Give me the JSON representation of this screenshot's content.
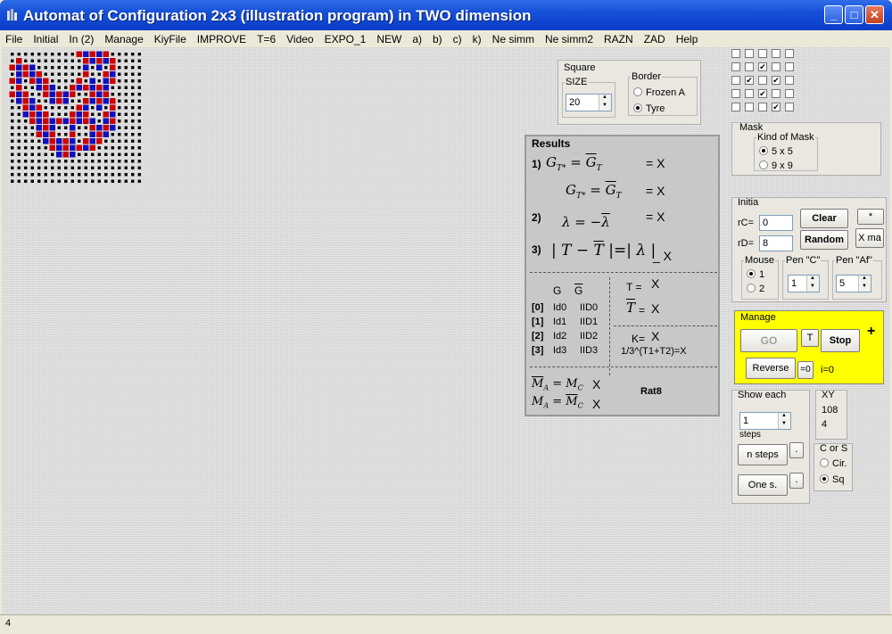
{
  "window": {
    "title": "Automat of Configuration 2x3 (illustration program) in TWO dimension"
  },
  "menu": [
    "File",
    "Initial",
    "In (2)",
    "Manage",
    "KiyFile",
    "IMPROVE",
    "T=6",
    "Video",
    "EXPO_1",
    "NEW",
    "a)",
    "b)",
    "c)",
    "k)",
    "Ne simm",
    "Ne simm2",
    "RAZN",
    "ZAD",
    "Help"
  ],
  "square": {
    "title": "Square",
    "size_label": "SIZE",
    "size_value": "20",
    "border_label": "Border",
    "border_options": [
      "Frozen A",
      "Tyre"
    ],
    "border_selected": "Tyre"
  },
  "results": {
    "title": "Results",
    "row1_num": "1)",
    "row2_num": "2)",
    "row3_num": "3)",
    "eq_x": "= X",
    "x": "X",
    "eq_modlambda": "_ X",
    "g_header": "G",
    "g_bar_header": "G",
    "rows": [
      {
        "idx": "[0]",
        "id": "Id0",
        "bid": "IID0"
      },
      {
        "idx": "[1]",
        "id": "Id1",
        "bid": "IID1"
      },
      {
        "idx": "[2]",
        "id": "Id2",
        "bid": "IID2"
      },
      {
        "idx": "[3]",
        "id": "Id3",
        "bid": "IID3"
      }
    ],
    "t_eq": "T =",
    "t_bar_eq": "=",
    "k_eq": "K=",
    "formula": "1/3^(T1+T2)=X",
    "rat": "Rat8"
  },
  "mask": {
    "title": "Mask",
    "kind_label": "Kind of Mask",
    "options": [
      "5 x 5",
      "9 x 9"
    ],
    "selected": "5 x 5"
  },
  "initia": {
    "title": "Initia",
    "rc_label": "rC=",
    "rc_value": "0",
    "rd_label": "rD=",
    "rd_value": "8",
    "clear_label": "Clear",
    "random_label": "Random",
    "small_label": "*",
    "xma_label": "X ma",
    "mouse_label": "Mouse",
    "mouse_options": [
      "1",
      "2"
    ],
    "mouse_selected": "1",
    "pen_c_label": "Pen \"C\"",
    "pen_c_value": "1",
    "pen_af_label": "Pen \"Af\"",
    "pen_af_value": "5"
  },
  "manage": {
    "title": "Manage",
    "go_label": "GO",
    "t_label": "T",
    "stop_label": "Stop",
    "plus_label": "+",
    "reverse_label": "Reverse",
    "zero_label": "=0",
    "i_text": "i=0"
  },
  "show_each": {
    "title": "Show each",
    "value": "1",
    "steps_label": "steps",
    "n_steps_label": "n steps",
    "one_label": "One s.",
    "dot_label": "."
  },
  "xy": {
    "title": "XY",
    "x_value": "108",
    "y_value": "4"
  },
  "cors": {
    "title": "C or S",
    "options": [
      "Cir.",
      "Sq"
    ],
    "selected": "Sq"
  },
  "status": {
    "text": "4"
  },
  "colors": {
    "title_bar": "#0a3cc8",
    "manage_bg": "#ffff00",
    "cell_red": "#cc0000",
    "cell_blue": "#1010c0",
    "cell_black": "#000000"
  },
  "checkgrid": [
    [
      0,
      0,
      0,
      0,
      0
    ],
    [
      0,
      0,
      1,
      0,
      0
    ],
    [
      0,
      1,
      0,
      1,
      0
    ],
    [
      0,
      0,
      1,
      0,
      0
    ],
    [
      0,
      0,
      0,
      1,
      0
    ]
  ],
  "automaton": {
    "size": 20,
    "rows": [
      "..........RBRBR.....",
      ".R.........RBRBR....",
      "RBRB.......B.B.R....",
      ".BRBR......R..RB....",
      "RB.RBR....R.B.BR....",
      ".R..BRB..RBRBRB.....",
      "RBR..RBRBR..RBR.....",
      ".BRB..BRB..RBRBR....",
      "..RBR.....RB.B.R....",
      "..BRBR...RBR..RB....",
      "...RBRBRBRBRB.BR....",
      "....BRB..B..RBRB....",
      "....RBR..R..BRB.....",
      ".....BRBRB.RBR......",
      "......RBRBRBR.......",
      ".......BRB..........",
      "....................",
      "....................",
      "....................",
      "...................."
    ]
  }
}
